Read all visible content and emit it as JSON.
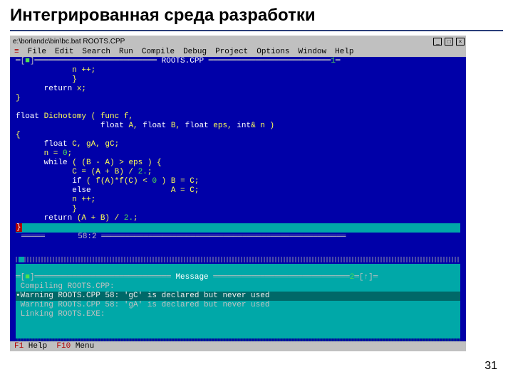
{
  "slide": {
    "title": "Интегрированная среда разработки",
    "page_number": "31"
  },
  "window": {
    "path": "e:\\borlandc\\bin\\bc.bat ROOTS.CPP",
    "buttons": {
      "min": "_",
      "max": "□",
      "close": "×"
    }
  },
  "menu": {
    "system": "≡",
    "items": [
      "File",
      "Edit",
      "Search",
      "Run",
      "Compile",
      "Debug",
      "Project",
      "Options",
      "Window",
      "Help"
    ]
  },
  "editor": {
    "filename": "ROOTS.CPP",
    "window_num": "1",
    "code_lines": [
      "            n ++;",
      "            }",
      "      return x;",
      "}",
      "",
      "float Dichotomy ( func f,",
      "                  float A, float B, float eps, int& n )",
      "{",
      "      float C, gA, gC;",
      "      n = 0;",
      "      while ( (B - A) > eps ) {",
      "            C = (A + B) / 2.;",
      "            if ( f(A)*f(C) < 0 ) B = C;",
      "            else                 A = C;",
      "            n ++;",
      "            }",
      "      return (A + B) / 2.;"
    ],
    "highlight_line": "}",
    "status": "      58:2"
  },
  "messages": {
    "title": "Message",
    "window_num": "2",
    "lines": [
      " Compiling ROOTS.CPP:",
      "•Warning ROOTS.CPP 58: 'gC' is declared but never used",
      " Warning ROOTS.CPP 58: 'gA' is declared but never used",
      " Linking ROOTS.EXE:"
    ]
  },
  "statusbar": {
    "f1": "F1",
    "f1_label": " Help  ",
    "f10": "F10",
    "f10_label": " Menu"
  }
}
